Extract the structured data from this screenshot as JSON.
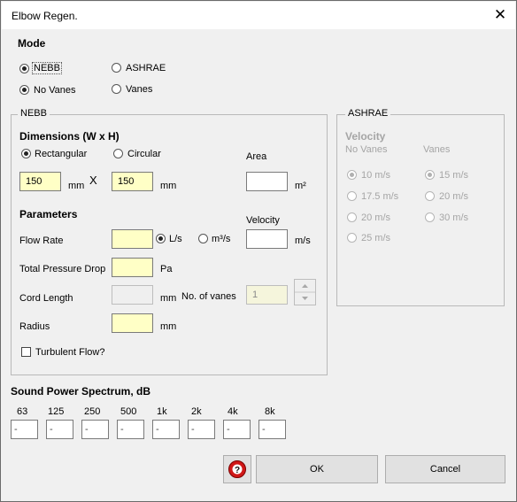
{
  "window": {
    "title": "Elbow Regen.",
    "close_glyph": "✕"
  },
  "mode": {
    "heading": "Mode",
    "options": [
      {
        "label": "NEBB",
        "selected": true
      },
      {
        "label": "ASHRAE",
        "selected": false
      },
      {
        "label": "No Vanes",
        "selected": true
      },
      {
        "label": "Vanes",
        "selected": false
      }
    ]
  },
  "nebb": {
    "group_label": "NEBB",
    "dimensions": {
      "heading": "Dimensions (W x H)",
      "rectangular_label": "Rectangular",
      "circular_label": "Circular",
      "shape_selected": "Rectangular",
      "width_value": "150",
      "width_unit": "mm",
      "times": "X",
      "height_value": "150",
      "height_unit": "mm",
      "area_label": "Area",
      "area_value": "",
      "area_unit": "m²"
    },
    "parameters": {
      "heading": "Parameters",
      "velocity_label": "Velocity",
      "velocity_value": "",
      "velocity_unit": "m/s",
      "flow_rate_label": "Flow Rate",
      "flow_rate_value": "",
      "flow_unit_ls": "L/s",
      "flow_unit_m3s": "m³/s",
      "flow_unit_selected": "L/s",
      "pressure_drop_label": "Total Pressure Drop",
      "pressure_drop_value": "",
      "pressure_drop_unit": "Pa",
      "cord_length_label": "Cord Length",
      "cord_length_value": "",
      "cord_length_unit": "mm",
      "vanes_label": "No. of vanes",
      "vanes_value": "1",
      "radius_label": "Radius",
      "radius_value": "",
      "radius_unit": "mm",
      "turbulent_label": "Turbulent Flow?",
      "turbulent_checked": false
    }
  },
  "ashrae": {
    "group_label": "ASHRAE",
    "velocity_heading": "Velocity",
    "no_vanes_label": "No Vanes",
    "vanes_label": "Vanes",
    "no_vanes_options": [
      {
        "label": "10 m/s",
        "selected": true
      },
      {
        "label": "17.5 m/s",
        "selected": false
      },
      {
        "label": "20 m/s",
        "selected": false
      },
      {
        "label": "25 m/s",
        "selected": false
      }
    ],
    "vanes_options": [
      {
        "label": "15 m/s",
        "selected": true
      },
      {
        "label": "20 m/s",
        "selected": false
      },
      {
        "label": "30 m/s",
        "selected": false
      }
    ]
  },
  "spectrum": {
    "heading": "Sound Power Spectrum, dB",
    "bands": [
      {
        "label": "63",
        "value": "-"
      },
      {
        "label": "125",
        "value": "-"
      },
      {
        "label": "250",
        "value": "-"
      },
      {
        "label": "500",
        "value": "-"
      },
      {
        "label": "1k",
        "value": "-"
      },
      {
        "label": "2k",
        "value": "-"
      },
      {
        "label": "4k",
        "value": "-"
      },
      {
        "label": "8k",
        "value": "-"
      }
    ]
  },
  "buttons": {
    "help_icon": "help-icon",
    "ok": "OK",
    "cancel": "Cancel"
  }
}
